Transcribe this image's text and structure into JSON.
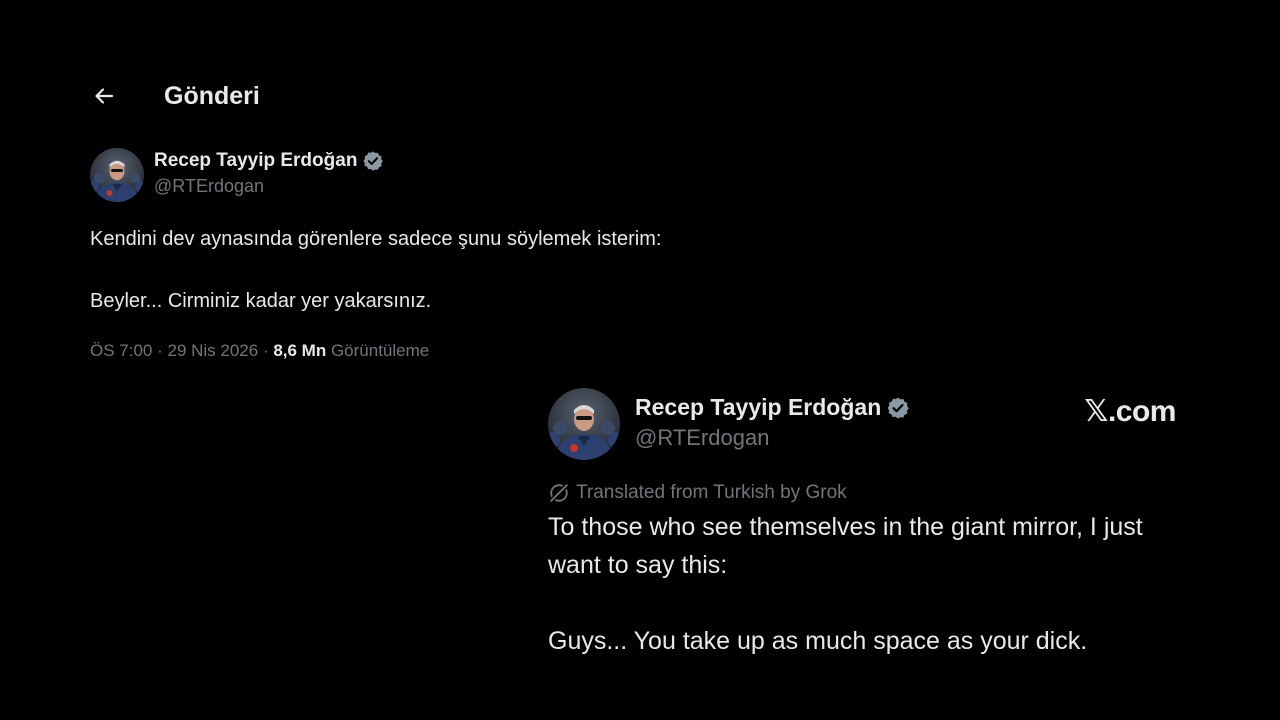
{
  "header": {
    "back_icon": "arrow-left-icon",
    "title": "Gönderi"
  },
  "post": {
    "author": {
      "name": "Recep Tayyip Erdoğan",
      "handle": "@RTErdogan",
      "verified": true,
      "verified_color": "#8b98a5",
      "avatar_icon": "profile-photo"
    },
    "paragraphs": [
      "Kendini dev aynasında görenlere sadece şunu söylemek isterim:",
      "Beyler... Cirminiz kadar yer yakarsınız."
    ],
    "meta": {
      "time": "ÖS 7:00",
      "separator1": " · ",
      "date": "29 Nis 2026",
      "separator2": " · ",
      "views_count": "8,6 Mn",
      "views_label": " Görüntüleme"
    }
  },
  "translation_card": {
    "author": {
      "name": "Recep Tayyip Erdoğan",
      "handle": "@RTErdogan",
      "verified": true
    },
    "brand": "𝕏.com",
    "translated_label": "Translated from Turkish by Grok",
    "translated_icon": "grok-icon",
    "paragraphs": [
      "To those who see themselves in the giant mirror, I just want to say this:",
      "Guys... You take up as much space as your dick."
    ]
  },
  "colors": {
    "background": "#000000",
    "text_primary": "#e7e9ea",
    "text_secondary": "#71767b"
  }
}
